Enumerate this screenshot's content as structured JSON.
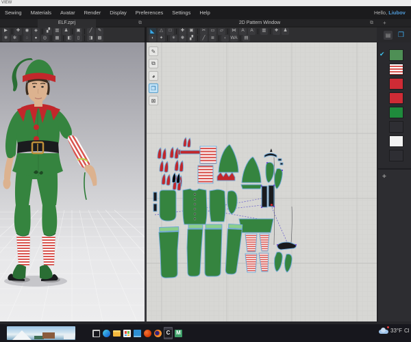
{
  "page": {
    "window_label": "VIEW"
  },
  "menu_bar": {
    "items": [
      "Sewing",
      "Materials",
      "Avatar",
      "Render",
      "Display",
      "Preferences",
      "Settings",
      "Help"
    ],
    "greeting_prefix": "Hello, ",
    "greeting_name": "Liubov"
  },
  "tabs": {
    "project_tab": "ELF.zprj",
    "pattern_window_title": "2D Pattern Window",
    "expand_icon": "⧉",
    "add_panel_icon": "+"
  },
  "toolbars": {
    "t3d_row1": [
      {
        "name": "simulate-tool",
        "glyph": "▶"
      },
      {
        "sep": true
      },
      {
        "name": "select-move-tool",
        "glyph": "✚"
      },
      {
        "name": "select-mesh-tool",
        "glyph": "◉"
      },
      {
        "name": "pin-tool",
        "glyph": "◈"
      },
      {
        "sep": true
      },
      {
        "name": "arrangement-tool",
        "glyph": "▞"
      },
      {
        "name": "garment-fit-tool",
        "glyph": "▥"
      },
      {
        "name": "avatar-display-tool",
        "glyph": "♟"
      },
      {
        "sep": true
      },
      {
        "name": "gizmo-tool",
        "glyph": "▣"
      },
      {
        "sep": true
      },
      {
        "name": "sewing-3d-tool",
        "glyph": "╱"
      },
      {
        "name": "measure-tool",
        "glyph": "✎"
      }
    ],
    "t3d_row2": [
      {
        "name": "pin-freeze-tool",
        "glyph": "❄"
      },
      {
        "name": "deactivate-tool",
        "glyph": "✻"
      },
      {
        "sep": true
      },
      {
        "name": "select-point-tool",
        "glyph": "◌"
      },
      {
        "name": "brush-tool",
        "glyph": "●"
      },
      {
        "name": "sphere-select-tool",
        "glyph": "◎"
      },
      {
        "sep": true
      },
      {
        "name": "garment-texture-tool",
        "glyph": "▦"
      },
      {
        "sep": true
      },
      {
        "name": "fold-arrangement-tool",
        "glyph": "◧"
      },
      {
        "name": "panel-display-tool",
        "glyph": "▯"
      },
      {
        "sep": true
      },
      {
        "name": "stitch-display-tool",
        "glyph": "◨"
      },
      {
        "name": "texture-display-tool",
        "glyph": "▩"
      }
    ],
    "t2d_row1": [
      {
        "name": "transform-pattern-tool",
        "glyph": "◣",
        "selected": true
      },
      {
        "name": "edit-pattern-tool",
        "glyph": "△"
      },
      {
        "name": "edit-point-tool",
        "glyph": "□"
      },
      {
        "sep": true
      },
      {
        "name": "add-point-tool",
        "glyph": "✚"
      },
      {
        "name": "image-tool",
        "glyph": "▣"
      },
      {
        "sep": true
      },
      {
        "name": "polygon-tool",
        "glyph": "✂"
      },
      {
        "name": "rectangle-tool",
        "glyph": "▭"
      },
      {
        "name": "circle-tool",
        "glyph": "▱"
      },
      {
        "sep": true
      },
      {
        "name": "dart-tool",
        "glyph": "⋈"
      },
      {
        "name": "text-tool",
        "glyph": "A"
      },
      {
        "name": "text-style-tool",
        "glyph": "A"
      },
      {
        "sep": true
      },
      {
        "name": "pleats-tool",
        "glyph": "▥"
      },
      {
        "sep": true
      },
      {
        "name": "cut-sew-tool",
        "glyph": "❖"
      },
      {
        "name": "trace-tool",
        "glyph": "♟"
      }
    ],
    "t2d_row2": [
      {
        "name": "seam-tool",
        "glyph": "◖"
      },
      {
        "name": "segment-sewing-tool",
        "glyph": "✦"
      },
      {
        "sep": true
      },
      {
        "name": "free-sewing-tool",
        "glyph": "✳"
      },
      {
        "name": "detach-sewing-tool",
        "glyph": "❋"
      },
      {
        "name": "flip-sewing-tool",
        "glyph": "▞"
      },
      {
        "sep": true
      },
      {
        "name": "notch-tool",
        "glyph": "╱"
      },
      {
        "name": "seam-allowance-tool",
        "glyph": "≣"
      },
      {
        "sep": true
      },
      {
        "name": "grading-tool",
        "glyph": "‹"
      },
      {
        "name": "measure-2d-tool",
        "glyph": "WA"
      },
      {
        "sep": true
      },
      {
        "name": "annotation-tool",
        "glyph": "▤"
      }
    ],
    "tool_strip": [
      {
        "name": "needle-tool",
        "glyph": "✎"
      },
      {
        "name": "pattern-outline-tool",
        "glyph": "⧉"
      },
      {
        "name": "sphere-view-tool",
        "glyph": "◕"
      },
      {
        "name": "fabric-view-tool",
        "glyph": "❐",
        "selected": true
      },
      {
        "name": "lock-tool",
        "glyph": "⊠"
      }
    ],
    "panel_tabs": [
      {
        "name": "object-browser-tab",
        "glyph": "▤"
      },
      {
        "name": "fabric-tab",
        "glyph": "❒",
        "selected": true
      }
    ]
  },
  "right_panel": {
    "swatches": [
      {
        "name": "fabric-green-dark",
        "type": "solid",
        "color": "#4e8f55",
        "checked": true
      },
      {
        "name": "fabric-stripe-red-white",
        "type": "stripes"
      },
      {
        "name": "fabric-red",
        "type": "solid",
        "color": "#cf2b35"
      },
      {
        "name": "fabric-red-2",
        "type": "solid",
        "color": "#cf2b35"
      },
      {
        "name": "fabric-green-bright",
        "type": "solid",
        "color": "#1f8b3c"
      },
      {
        "name": "fabric-dark",
        "type": "solid",
        "color": "#2e2e33"
      },
      {
        "name": "fabric-white",
        "type": "solid",
        "color": "#f2f2f2"
      },
      {
        "name": "fabric-dark-2",
        "type": "solid",
        "color": "#2e2e33"
      }
    ],
    "add_icon": "✚"
  },
  "taskbar": {
    "icons": [
      {
        "name": "task-view-button"
      },
      {
        "name": "edge-app"
      },
      {
        "name": "file-explorer-app"
      },
      {
        "name": "microsoft-store-app"
      },
      {
        "name": "mail-app"
      },
      {
        "name": "office-app"
      },
      {
        "name": "firefox-app"
      },
      {
        "name": "clo3d-app",
        "label": "C",
        "active": true
      },
      {
        "name": "marvelous-designer-app",
        "label": "M"
      }
    ],
    "weather": {
      "temp": "33°F",
      "condition": "Cl"
    }
  },
  "colors": {
    "elf_green": "#35843f",
    "elf_green_dark": "#2a6e34",
    "elf_red": "#c2272b",
    "stripe_red": "#d9534e",
    "stripe_white": "#fcfcfc",
    "skin": "#dcb28f",
    "hair": "#3c2c1e",
    "belt_black": "#1a1b1e",
    "buckle_gold": "#c0913a",
    "accent_blue": "#38a8e8",
    "pattern_outline": "#6fa8d6",
    "seam_purple": "#5b51c9",
    "waistband_green": "#8ccf8c",
    "canvas_bg": "#d7d7d4",
    "panel_bg": "#2a2a2e"
  }
}
